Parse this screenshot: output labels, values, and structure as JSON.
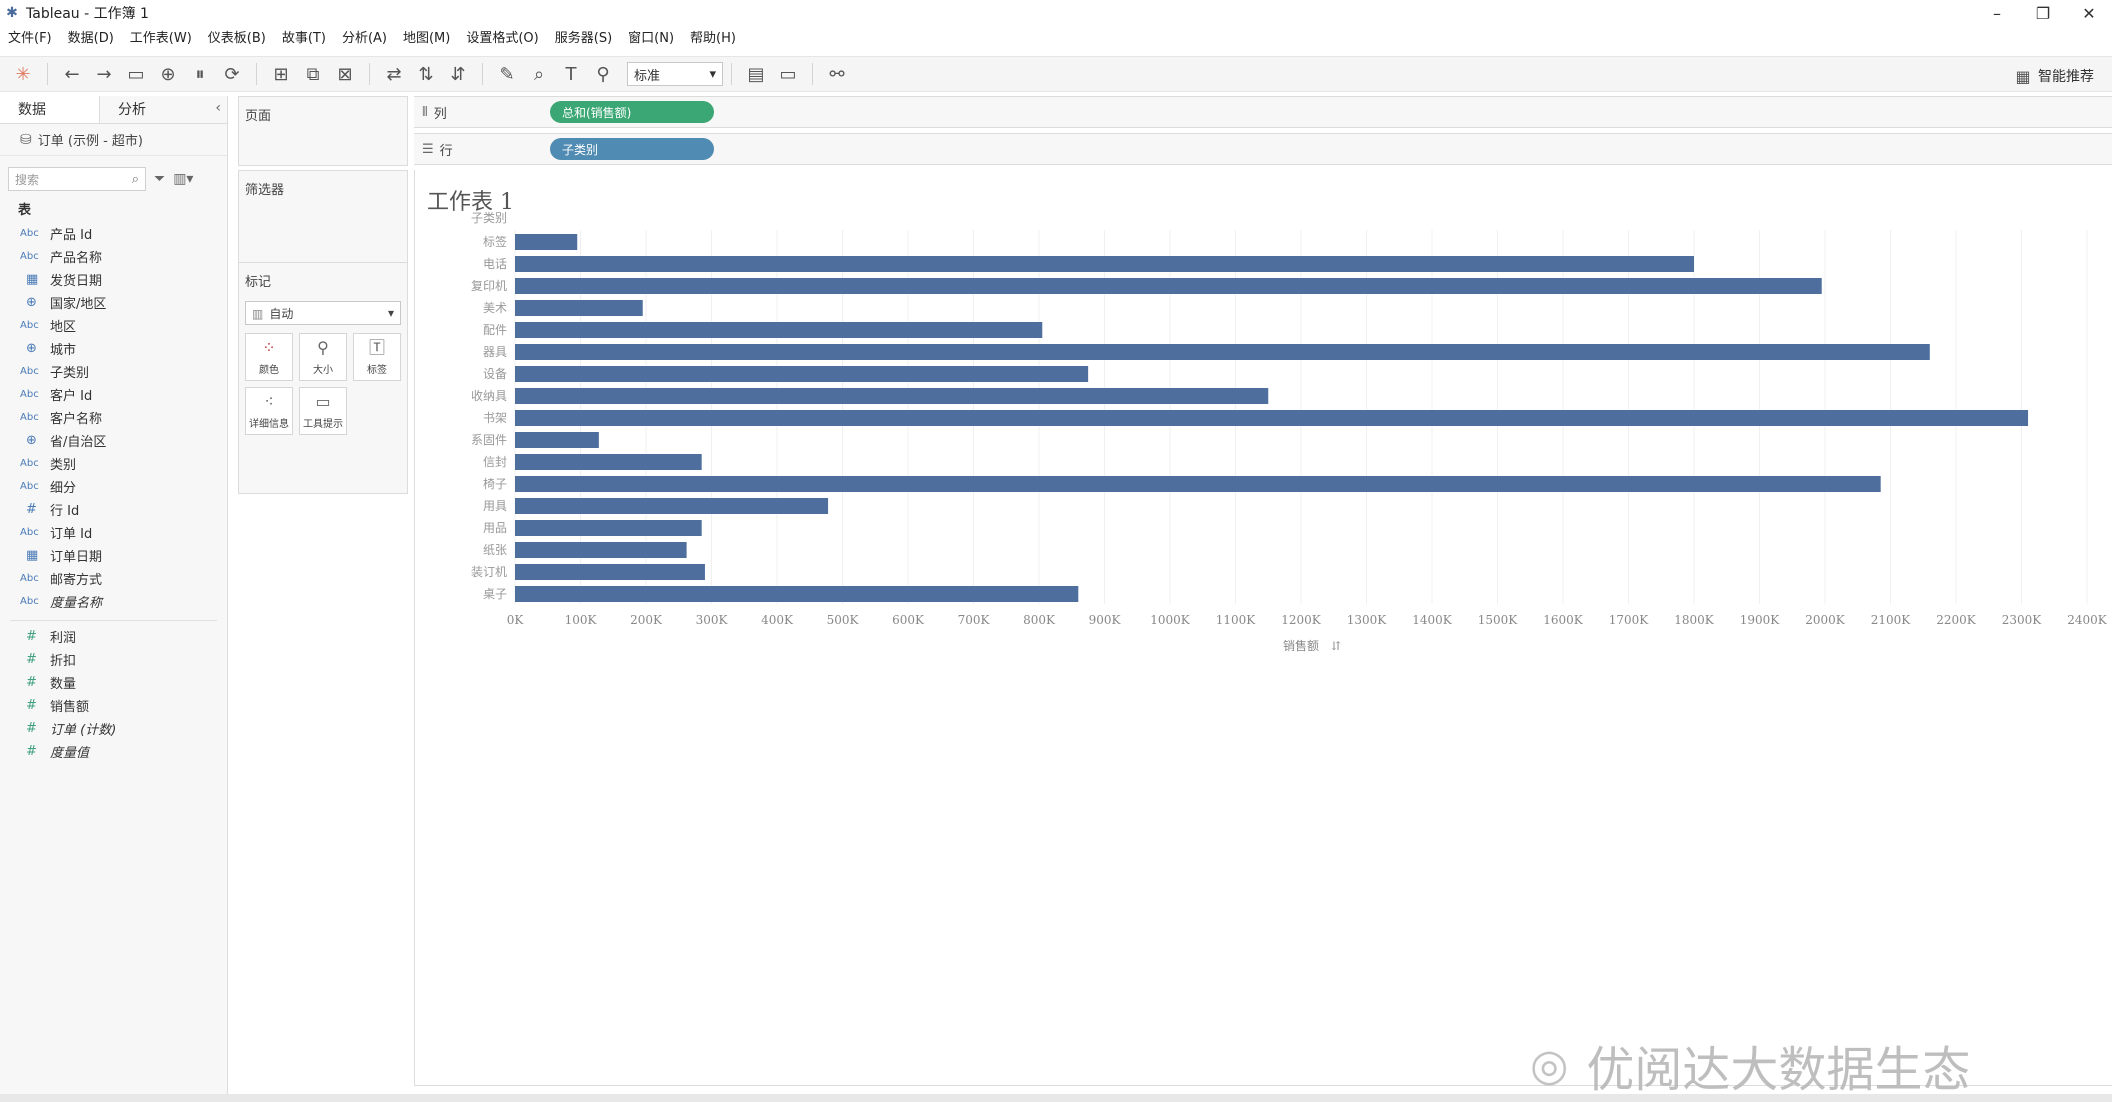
{
  "window": {
    "title": "Tableau - 工作簿 1",
    "app_icon": "tableau-logo-icon"
  },
  "menu": [
    "文件(F)",
    "数据(D)",
    "工作表(W)",
    "仪表板(B)",
    "故事(T)",
    "分析(A)",
    "地图(M)",
    "设置格式(O)",
    "服务器(S)",
    "窗口(N)",
    "帮助(H)"
  ],
  "toolbar": {
    "fit_select": "标准",
    "show_me_label": "智能推荐"
  },
  "data_pane": {
    "tabs": [
      "数据",
      "分析"
    ],
    "datasource": "订单 (示例 - 超市)",
    "search_placeholder": "搜索",
    "section_title": "表",
    "dimensions": [
      {
        "type": "Abc",
        "name": "产品 Id"
      },
      {
        "type": "Abc",
        "name": "产品名称"
      },
      {
        "type": "date",
        "name": "发货日期"
      },
      {
        "type": "geo",
        "name": "国家/地区"
      },
      {
        "type": "Abc",
        "name": "地区"
      },
      {
        "type": "geo",
        "name": "城市"
      },
      {
        "type": "Abc",
        "name": "子类别"
      },
      {
        "type": "Abc",
        "name": "客户 Id"
      },
      {
        "type": "Abc",
        "name": "客户名称"
      },
      {
        "type": "geo",
        "name": "省/自治区"
      },
      {
        "type": "Abc",
        "name": "类别"
      },
      {
        "type": "Abc",
        "name": "细分"
      },
      {
        "type": "#",
        "name": "行 Id"
      },
      {
        "type": "Abc",
        "name": "订单 Id"
      },
      {
        "type": "date",
        "name": "订单日期"
      },
      {
        "type": "Abc",
        "name": "邮寄方式"
      },
      {
        "type": "Abc",
        "name": "度量名称",
        "italic": true
      }
    ],
    "measures": [
      {
        "type": "#",
        "name": "利润"
      },
      {
        "type": "#",
        "name": "折扣"
      },
      {
        "type": "#",
        "name": "数量"
      },
      {
        "type": "#",
        "name": "销售额"
      },
      {
        "type": "#",
        "name": "订单 (计数)",
        "italic": true
      },
      {
        "type": "#",
        "name": "度量值",
        "italic": true
      }
    ]
  },
  "cards": {
    "pages": "页面",
    "filters": "筛选器",
    "marks": "标记",
    "mark_type": "自动",
    "mark_buttons": [
      {
        "icon": "color-icon",
        "label": "颜色"
      },
      {
        "icon": "size-icon",
        "label": "大小"
      },
      {
        "icon": "label-icon",
        "label": "标签"
      },
      {
        "icon": "detail-icon",
        "label": "详细信息"
      },
      {
        "icon": "tooltip-icon",
        "label": "工具提示"
      }
    ]
  },
  "shelves": {
    "columns_label": "列",
    "columns_pill": "总和(销售额)",
    "rows_label": "行",
    "rows_pill": "子类别"
  },
  "worksheet": {
    "title": "工作表 1"
  },
  "chart_data": {
    "type": "bar",
    "orientation": "horizontal",
    "row_header": "子类别",
    "categories": [
      "标签",
      "电话",
      "复印机",
      "美术",
      "配件",
      "器具",
      "设备",
      "收纳具",
      "书架",
      "系固件",
      "信封",
      "椅子",
      "用具",
      "用品",
      "纸张",
      "装订机",
      "桌子"
    ],
    "values": [
      95000,
      1800000,
      1995000,
      195000,
      805000,
      2160000,
      875000,
      1150000,
      2310000,
      128000,
      285000,
      2085000,
      478000,
      285000,
      262000,
      290000,
      860000
    ],
    "xlabel": "销售额",
    "xlim": [
      0,
      2400000
    ],
    "ticks": [
      "0K",
      "100K",
      "200K",
      "300K",
      "400K",
      "500K",
      "600K",
      "700K",
      "800K",
      "900K",
      "1000K",
      "1100K",
      "1200K",
      "1300K",
      "1400K",
      "1500K",
      "1600K",
      "1700K",
      "1800K",
      "1900K",
      "2000K",
      "2100K",
      "2200K",
      "2300K",
      "2400K"
    ],
    "bar_color": "#4e6e9d",
    "grid": true
  },
  "watermark": "优阅达大数据生态"
}
